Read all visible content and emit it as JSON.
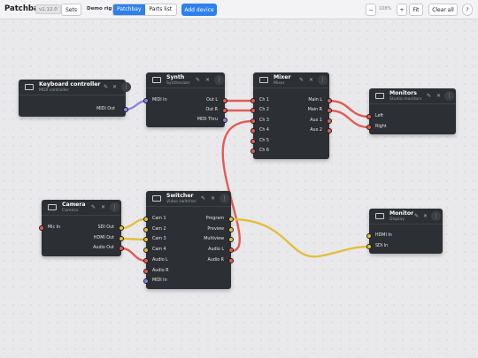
{
  "toolbar": {
    "app_title": "Patchbay",
    "version": "v1.12.0",
    "sets_label": "Sets",
    "rig_name": "Demo rig",
    "view_patchbay": "Patchbay",
    "view_parts": "Parts list",
    "add_device": "Add device",
    "zoom_out": "−",
    "zoom_level": "108%",
    "zoom_in": "+",
    "fit": "Fit",
    "clear_all": "Clear all",
    "help": "?"
  },
  "colors": {
    "audio": "#e25b52",
    "video": "#e3bf3d",
    "midi": "#8b84e6",
    "node_bg": "#2c2f33",
    "accent": "#2f80ed"
  },
  "icons": {
    "edit": "✎",
    "close": "✕",
    "menu": "⋮"
  },
  "devices": {
    "keyboard": {
      "title": "Keyboard controller",
      "subtitle": "MIDI controller",
      "outputs": [
        "MIDI Out"
      ]
    },
    "synth": {
      "title": "Synth",
      "subtitle": "Synthesizer",
      "inputs": [
        "MIDI In"
      ],
      "outputs": [
        "Out L",
        "Out R",
        "MIDI Thru"
      ]
    },
    "mixer": {
      "title": "Mixer",
      "subtitle": "Mixer",
      "inputs": [
        "Ch 1",
        "Ch 2",
        "Ch 3",
        "Ch 4",
        "Ch 5",
        "Ch 6"
      ],
      "outputs": [
        "Main L",
        "Main R",
        "Aux 1",
        "Aux 2"
      ]
    },
    "monitors": {
      "title": "Monitors",
      "subtitle": "Studio monitors",
      "inputs": [
        "Left",
        "Right"
      ]
    },
    "camera": {
      "title": "Camera",
      "subtitle": "Camera",
      "inputs": [
        "Mic In"
      ],
      "outputs": [
        "SDI Out",
        "HDMI Out",
        "Audio Out"
      ]
    },
    "switcher": {
      "title": "Switcher",
      "subtitle": "Video switcher",
      "inputs": [
        "Cam 1",
        "Cam 2",
        "Cam 3",
        "Cam 4",
        "Audio L",
        "Audio R",
        "MIDI In"
      ],
      "outputs": [
        "Program",
        "Preview",
        "Multiview",
        "Audio L",
        "Audio R"
      ]
    },
    "monitor": {
      "title": "Monitor",
      "subtitle": "Display",
      "inputs": [
        "HDMI In",
        "SDI In"
      ]
    }
  }
}
